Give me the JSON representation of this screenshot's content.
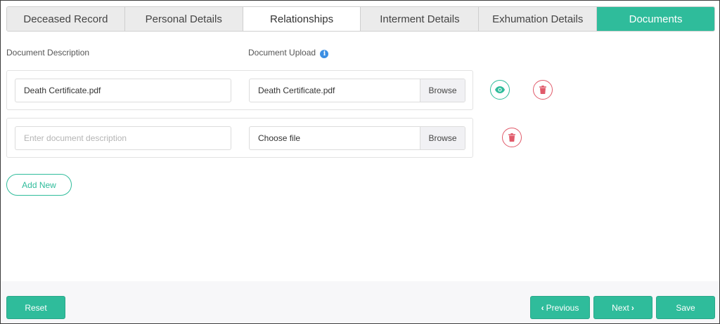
{
  "tabs": [
    {
      "label": "Deceased Record"
    },
    {
      "label": "Personal Details"
    },
    {
      "label": "Relationships"
    },
    {
      "label": "Interment Details"
    },
    {
      "label": "Exhumation Details"
    },
    {
      "label": "Documents"
    }
  ],
  "columns": {
    "description_label": "Document Description",
    "upload_label": "Document Upload"
  },
  "documents": [
    {
      "description": "Death Certificate.pdf",
      "file": "Death Certificate.pdf",
      "browse_label": "Browse"
    },
    {
      "description_placeholder": "Enter document description",
      "file": "Choose file",
      "browse_label": "Browse"
    }
  ],
  "add_new_label": "Add New",
  "footer": {
    "reset_label": "Reset",
    "previous_label": "Previous",
    "next_label": "Next",
    "save_label": "Save"
  },
  "colors": {
    "accent": "#2fbc9b",
    "danger": "#e05a6a",
    "info": "#3b8fe3"
  },
  "icons": {
    "view": "eye-icon",
    "delete": "trash-icon",
    "info": "info-icon",
    "previous": "chevron-left-icon",
    "next": "chevron-right-icon"
  }
}
